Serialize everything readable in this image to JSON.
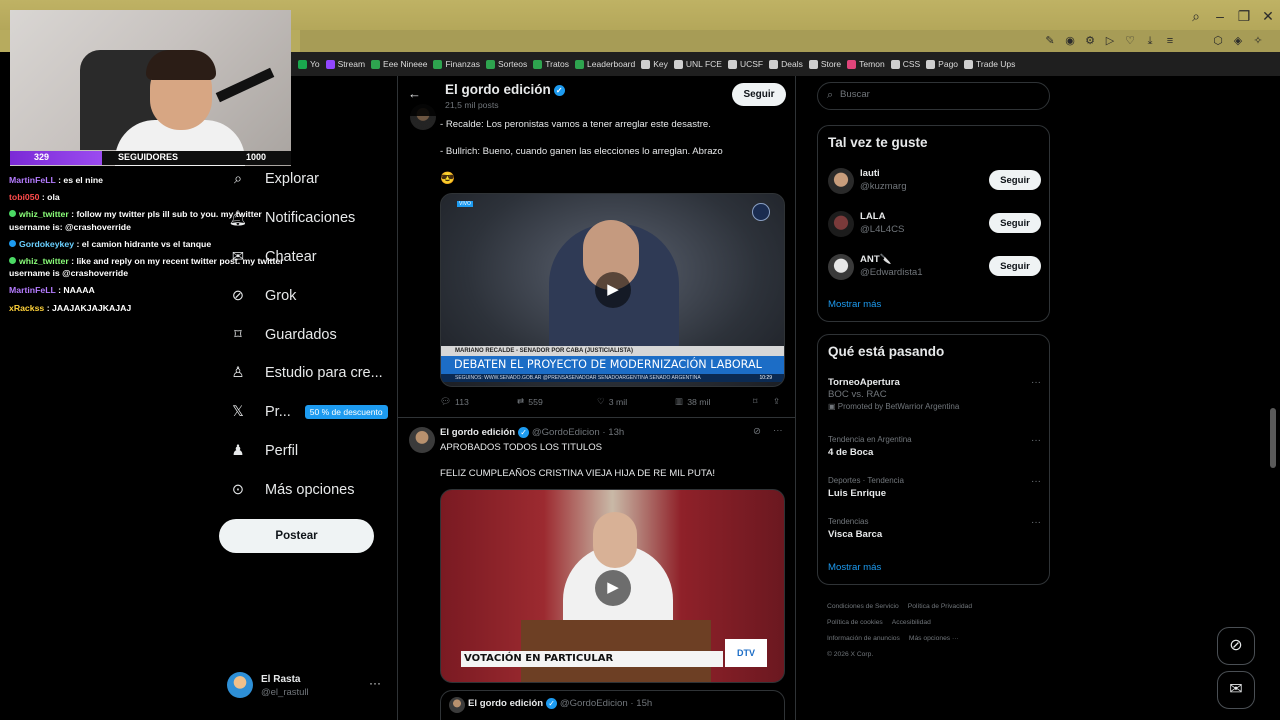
{
  "stream": {
    "followers": {
      "current": "329",
      "label": "SEGUIDORES",
      "goal": "1000",
      "progress_fraction": 0.329
    },
    "chat": [
      {
        "user": "MartinFeLL",
        "color": "#b57cff",
        "text": ": es el nine"
      },
      {
        "user": "tobi050",
        "color": "#ff4b4b",
        "text": ": ola"
      },
      {
        "user": "whiz_twitter",
        "color": "#8bff7a",
        "badge": "#4bd964",
        "text": ": follow my twitter pls ill sub to you. my twitter username is: @crashoverride"
      },
      {
        "user": "Gordokeykey",
        "color": "#6ad0ff",
        "badge": "#1d9bf0",
        "text": ": el camion hidrante vs el tanque"
      },
      {
        "user": "whiz_twitter",
        "color": "#8bff7a",
        "badge": "#4bd964",
        "text": ": like and reply on my recent twitter post. my twitter username is @crashoverride"
      },
      {
        "user": "MartinFeLL",
        "color": "#b57cff",
        "text": ": NAAAA"
      },
      {
        "user": "xRackss",
        "color": "#ffd23a",
        "text": ": JAAJAKJAJKAJAJ"
      }
    ]
  },
  "bookmarks": [
    {
      "label": "Yo",
      "color": "#1aa84e"
    },
    {
      "label": "Stream",
      "color": "#9146ff"
    },
    {
      "label": "Eee Nineee",
      "color": "#2ea44f"
    },
    {
      "label": "Finanzas",
      "color": "#2ea44f"
    },
    {
      "label": "Sorteos",
      "color": "#2ea44f"
    },
    {
      "label": "Tratos",
      "color": "#2ea44f"
    },
    {
      "label": "Leaderboard",
      "color": "#2ea44f"
    },
    {
      "label": "Key",
      "color": "#cfcfcf"
    },
    {
      "label": "UNL FCE",
      "color": "#cfcfcf"
    },
    {
      "label": "UCSF",
      "color": "#cfcfcf"
    },
    {
      "label": "Deals",
      "color": "#cfcfcf"
    },
    {
      "label": "Store",
      "color": "#cfcfcf"
    },
    {
      "label": "Temon",
      "color": "#e0457b"
    },
    {
      "label": "CSS",
      "color": "#cfcfcf"
    },
    {
      "label": "Pago",
      "color": "#cfcfcf"
    },
    {
      "label": "Trade Ups",
      "color": "#cfcfcf"
    }
  ],
  "nav": {
    "items": [
      {
        "label": "Explorar",
        "icon": "search-icon"
      },
      {
        "label": "Notificaciones",
        "icon": "bell-icon"
      },
      {
        "label": "Chatear",
        "icon": "mail-icon"
      },
      {
        "label": "Grok",
        "icon": "grok-icon"
      },
      {
        "label": "Guardados",
        "icon": "bookmark-icon"
      },
      {
        "label": "Estudio para cre...",
        "icon": "studio-icon"
      },
      {
        "label": "Pr...",
        "icon": "x-logo-icon",
        "promo": "50 % de descuento"
      },
      {
        "label": "Perfil",
        "icon": "person-icon"
      },
      {
        "label": "Más opciones",
        "icon": "more-circle-icon"
      }
    ],
    "post_button": "Postear"
  },
  "account": {
    "name": "El Rasta",
    "handle": "@el_rastull"
  },
  "profile_header": {
    "title": "El gordo edición",
    "subtitle": "21,5 mil posts",
    "follow": "Seguir"
  },
  "tweet1": {
    "lines": [
      "- Recalde: Los peronistas vamos a tener arreglar este desastre.",
      "- Bullrich: Bueno, cuando ganen las elecciones lo arreglan. Abrazo",
      "😎"
    ],
    "media": {
      "live_tag": "VIVO",
      "name_strip": "MARIANO RECALDE - SENADOR POR CABA (JUSTICIALISTA)",
      "headline": "DEBATEN EL PROYECTO DE MODERNIZACIÓN LABORAL",
      "ticker": "SEGUINOS:  WWW.SENADO.GOB.AR   @PRENSASENADOAR   SENADOARGENTINA   SENADO ARGENTINA",
      "time": "10:29"
    },
    "stats": {
      "replies": "113",
      "reposts": "559",
      "likes": "3 mil",
      "views": "38 mil"
    }
  },
  "tweet2": {
    "author": "El gordo edición",
    "handle": "@GordoEdicion",
    "time": "· 13h",
    "lines": [
      "APROBADOS TODOS LOS TITULOS",
      "FELIZ CUMPLEAÑOS CRISTINA VIEJA HIJA DE RE MIL PUTA!"
    ],
    "media": {
      "caption": "VOTACIÓN EN PARTICULAR",
      "logo": "DTV"
    }
  },
  "quoted": {
    "author": "El gordo edición",
    "handle": "@GordoEdicion",
    "time": "· 15h"
  },
  "sidebar": {
    "search_placeholder": "Buscar",
    "who_to_follow": {
      "title": "Tal vez te guste",
      "users": [
        {
          "name": "lauti",
          "handle": "@kuzmarg",
          "button": "Seguir"
        },
        {
          "name": "LALA",
          "handle": "@L4L4CS",
          "button": "Seguir"
        },
        {
          "name": "ANT🔪",
          "handle": "@Edwardista1",
          "button": "Seguir"
        }
      ],
      "show_more": "Mostrar más"
    },
    "trends": {
      "title": "Qué está pasando",
      "items": [
        {
          "meta": "",
          "name": "TorneoApertura",
          "sub": "BOC vs. RAC",
          "promo": "Promoted by BetWarrior Argentina"
        },
        {
          "meta": "Tendencia en Argentina",
          "name": "4 de Boca",
          "sub": "",
          "promo": ""
        },
        {
          "meta": "Deportes · Tendencia",
          "name": "Luis Enrique",
          "sub": "",
          "promo": ""
        },
        {
          "meta": "Tendencias",
          "name": "Visca Barca",
          "sub": "",
          "promo": ""
        }
      ],
      "show_more": "Mostrar más"
    },
    "footer": [
      "Condiciones de Servicio",
      "Política de Privacidad",
      "Política de cookies",
      "Accesibilidad",
      "Información de anuncios",
      "Más opciones ···",
      "© 2026 X Corp."
    ]
  }
}
